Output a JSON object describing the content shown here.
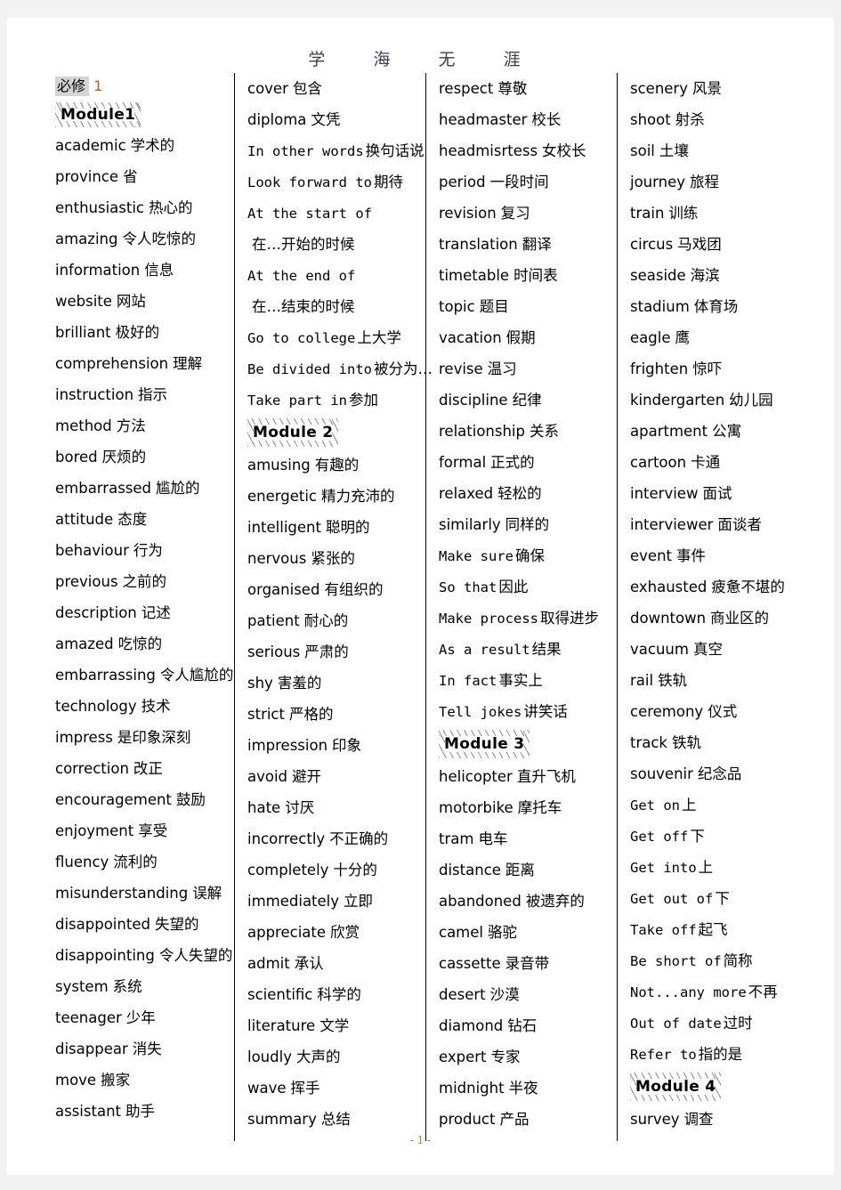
{
  "header": {
    "title": "学  海  无  涯"
  },
  "footer": {
    "prefix": "- ",
    "page_number": "1",
    "suffix": " -"
  },
  "subject": {
    "label_cn": "必修",
    "label_num": "1"
  },
  "columns": [
    {
      "id": "column-1",
      "items": [
        {
          "type": "subject",
          "cn": "必修",
          "num": "1"
        },
        {
          "type": "module",
          "label": "Module1"
        },
        {
          "type": "word",
          "en": "academic",
          "zh": "学术的"
        },
        {
          "type": "word",
          "en": "province",
          "zh": "省"
        },
        {
          "type": "word",
          "en": "enthusiastic",
          "zh": "热心的"
        },
        {
          "type": "word",
          "en": "amazing",
          "zh": "令人吃惊的"
        },
        {
          "type": "word",
          "en": "information",
          "zh": "信息"
        },
        {
          "type": "word",
          "en": "website",
          "zh": "网站"
        },
        {
          "type": "word",
          "en": "brilliant",
          "zh": "极好的"
        },
        {
          "type": "word",
          "en": "comprehension",
          "zh": "理解"
        },
        {
          "type": "word",
          "en": "instruction",
          "zh": "指示"
        },
        {
          "type": "word",
          "en": "method",
          "zh": "方法"
        },
        {
          "type": "word",
          "en": "bored",
          "zh": "厌烦的"
        },
        {
          "type": "word",
          "en": "embarrassed",
          "zh": "尴尬的"
        },
        {
          "type": "word",
          "en": "attitude",
          "zh": "态度"
        },
        {
          "type": "word",
          "en": "behaviour",
          "zh": "行为"
        },
        {
          "type": "word",
          "en": "previous",
          "zh": "之前的"
        },
        {
          "type": "word",
          "en": "description",
          "zh": "记述"
        },
        {
          "type": "word",
          "en": "amazed",
          "zh": "吃惊的"
        },
        {
          "type": "word",
          "en": "embarrassing",
          "zh": "令人尴尬的"
        },
        {
          "type": "word",
          "en": "technology",
          "zh": "技术"
        },
        {
          "type": "word",
          "en": "impress",
          "zh": "是印象深刻"
        },
        {
          "type": "word",
          "en": "correction",
          "zh": "改正"
        },
        {
          "type": "word",
          "en": "encouragement",
          "zh": "鼓励"
        },
        {
          "type": "word",
          "en": "enjoyment",
          "zh": "享受"
        },
        {
          "type": "word",
          "en": "fluency",
          "zh": "流利的"
        },
        {
          "type": "word",
          "en": "misunderstanding",
          "zh": "误解"
        },
        {
          "type": "word",
          "en": "disappointed",
          "zh": "失望的"
        },
        {
          "type": "word",
          "en": "disappointing",
          "zh": "令人失望的"
        },
        {
          "type": "word",
          "en": "system",
          "zh": "系统"
        },
        {
          "type": "word",
          "en": "teenager",
          "zh": "少年"
        },
        {
          "type": "word",
          "en": "disappear",
          "zh": "消失"
        },
        {
          "type": "word",
          "en": "move",
          "zh": "搬家"
        },
        {
          "type": "word",
          "en": "assistant",
          "zh": "助手"
        }
      ]
    },
    {
      "id": "column-2",
      "items": [
        {
          "type": "word",
          "en": "cover",
          "zh": "包含"
        },
        {
          "type": "word",
          "en": "diploma",
          "zh": "文凭"
        },
        {
          "type": "phrase",
          "en": "In other words",
          "zh": "换句话说"
        },
        {
          "type": "phrase",
          "en": "Look forward to",
          "zh": "期待"
        },
        {
          "type": "phrase",
          "en": "At the start of",
          "zh": ""
        },
        {
          "type": "word",
          "en": "",
          "zh": "在…开始的时候"
        },
        {
          "type": "phrase",
          "en": "At the end of",
          "zh": ""
        },
        {
          "type": "word",
          "en": "",
          "zh": "在…结束的时候"
        },
        {
          "type": "phrase",
          "en": "Go to college",
          "zh": "上大学"
        },
        {
          "type": "phrase",
          "en": "Be divided into",
          "zh": "被分为…"
        },
        {
          "type": "phrase",
          "en": "Take part in",
          "zh": "参加"
        },
        {
          "type": "module",
          "label": "Module 2"
        },
        {
          "type": "word",
          "en": "amusing",
          "zh": "有趣的"
        },
        {
          "type": "word",
          "en": "energetic",
          "zh": "精力充沛的"
        },
        {
          "type": "word",
          "en": "intelligent",
          "zh": "聪明的"
        },
        {
          "type": "word",
          "en": "nervous",
          "zh": "紧张的"
        },
        {
          "type": "word",
          "en": "organised",
          "zh": "有组织的"
        },
        {
          "type": "word",
          "en": "patient",
          "zh": "耐心的"
        },
        {
          "type": "word",
          "en": "serious",
          "zh": "严肃的"
        },
        {
          "type": "word",
          "en": "shy",
          "zh": "害羞的"
        },
        {
          "type": "word",
          "en": "strict",
          "zh": "严格的"
        },
        {
          "type": "word",
          "en": "impression",
          "zh": "印象"
        },
        {
          "type": "word",
          "en": "avoid",
          "zh": "避开"
        },
        {
          "type": "word",
          "en": "hate",
          "zh": "讨厌"
        },
        {
          "type": "word",
          "en": "incorrectly",
          "zh": "不正确的"
        },
        {
          "type": "word",
          "en": "completely",
          "zh": "十分的"
        },
        {
          "type": "word",
          "en": "immediately",
          "zh": "立即"
        },
        {
          "type": "word",
          "en": "appreciate",
          "zh": "欣赏"
        },
        {
          "type": "word",
          "en": "admit",
          "zh": "承认"
        },
        {
          "type": "word",
          "en": "scientific",
          "zh": "科学的"
        },
        {
          "type": "word",
          "en": "literature",
          "zh": "文学"
        },
        {
          "type": "word",
          "en": "loudly",
          "zh": "大声的"
        },
        {
          "type": "word",
          "en": "wave",
          "zh": "挥手"
        },
        {
          "type": "word",
          "en": "summary",
          "zh": "总结"
        }
      ]
    },
    {
      "id": "column-3",
      "items": [
        {
          "type": "word",
          "en": "respect",
          "zh": "尊敬"
        },
        {
          "type": "word",
          "en": "headmaster",
          "zh": "校长"
        },
        {
          "type": "word",
          "en": "headmisrtess",
          "zh": "女校长"
        },
        {
          "type": "word",
          "en": "period",
          "zh": "一段时间"
        },
        {
          "type": "word",
          "en": "revision",
          "zh": "复习"
        },
        {
          "type": "word",
          "en": "translation",
          "zh": "翻译"
        },
        {
          "type": "word",
          "en": "timetable",
          "zh": "时间表"
        },
        {
          "type": "word",
          "en": "topic",
          "zh": "题目"
        },
        {
          "type": "word",
          "en": "vacation",
          "zh": "假期"
        },
        {
          "type": "word",
          "en": "revise",
          "zh": "温习"
        },
        {
          "type": "word",
          "en": "discipline",
          "zh": "纪律"
        },
        {
          "type": "word",
          "en": "relationship",
          "zh": "关系"
        },
        {
          "type": "word",
          "en": "formal",
          "zh": "正式的"
        },
        {
          "type": "word",
          "en": "relaxed",
          "zh": "轻松的"
        },
        {
          "type": "word",
          "en": "similarly",
          "zh": "同样的"
        },
        {
          "type": "phrase",
          "en": "Make sure",
          "zh": "确保"
        },
        {
          "type": "phrase",
          "en": "So that",
          "zh": "因此"
        },
        {
          "type": "phrase",
          "en": "Make process",
          "zh": "取得进步"
        },
        {
          "type": "phrase",
          "en": "As a result",
          "zh": "结果"
        },
        {
          "type": "phrase",
          "en": "In fact",
          "zh": "事实上"
        },
        {
          "type": "phrase",
          "en": "Tell jokes",
          "zh": "讲笑话"
        },
        {
          "type": "module",
          "label": "Module 3"
        },
        {
          "type": "word",
          "en": "helicopter",
          "zh": "直升飞机"
        },
        {
          "type": "word",
          "en": "motorbike",
          "zh": "摩托车"
        },
        {
          "type": "word",
          "en": "tram",
          "zh": "电车"
        },
        {
          "type": "word",
          "en": "distance",
          "zh": "距离"
        },
        {
          "type": "word",
          "en": "abandoned",
          "zh": "被遗弃的"
        },
        {
          "type": "word",
          "en": "camel",
          "zh": "骆驼"
        },
        {
          "type": "word",
          "en": "cassette",
          "zh": "录音带"
        },
        {
          "type": "word",
          "en": "desert",
          "zh": "沙漠"
        },
        {
          "type": "word",
          "en": "diamond",
          "zh": "钻石"
        },
        {
          "type": "word",
          "en": "expert",
          "zh": "专家"
        },
        {
          "type": "word",
          "en": "midnight",
          "zh": "半夜"
        },
        {
          "type": "word",
          "en": "product",
          "zh": "产品"
        }
      ]
    },
    {
      "id": "column-4",
      "items": [
        {
          "type": "word",
          "en": "scenery",
          "zh": "风景"
        },
        {
          "type": "word",
          "en": "shoot",
          "zh": "射杀"
        },
        {
          "type": "word",
          "en": "soil",
          "zh": "土壤"
        },
        {
          "type": "word",
          "en": "journey",
          "zh": "旅程"
        },
        {
          "type": "word",
          "en": "train",
          "zh": "训练"
        },
        {
          "type": "word",
          "en": "circus",
          "zh": "马戏团"
        },
        {
          "type": "word",
          "en": "seaside",
          "zh": "海滨"
        },
        {
          "type": "word",
          "en": "stadium",
          "zh": "体育场"
        },
        {
          "type": "word",
          "en": "eagle",
          "zh": "鹰"
        },
        {
          "type": "word",
          "en": "frighten",
          "zh": "惊吓"
        },
        {
          "type": "word",
          "en": "kindergarten",
          "zh": "幼儿园"
        },
        {
          "type": "word",
          "en": "apartment",
          "zh": "公寓"
        },
        {
          "type": "word",
          "en": "cartoon",
          "zh": "卡通"
        },
        {
          "type": "word",
          "en": "interview",
          "zh": "面试"
        },
        {
          "type": "word",
          "en": "interviewer",
          "zh": "面谈者"
        },
        {
          "type": "word",
          "en": "event",
          "zh": "事件"
        },
        {
          "type": "word",
          "en": "exhausted",
          "zh": "疲惫不堪的"
        },
        {
          "type": "word",
          "en": "downtown",
          "zh": "商业区的"
        },
        {
          "type": "word",
          "en": "vacuum",
          "zh": "真空"
        },
        {
          "type": "word",
          "en": "rail",
          "zh": "铁轨"
        },
        {
          "type": "word",
          "en": "ceremony",
          "zh": "仪式"
        },
        {
          "type": "word",
          "en": "track",
          "zh": "铁轨"
        },
        {
          "type": "word",
          "en": "souvenir",
          "zh": "纪念品"
        },
        {
          "type": "phrase",
          "en": "Get on",
          "zh": "上"
        },
        {
          "type": "phrase",
          "en": "Get off",
          "zh": "下"
        },
        {
          "type": "phrase",
          "en": "Get into",
          "zh": "上"
        },
        {
          "type": "phrase",
          "en": "Get out of",
          "zh": "下"
        },
        {
          "type": "phrase",
          "en": "Take off",
          "zh": "起飞"
        },
        {
          "type": "phrase",
          "en": "Be short of",
          "zh": "简称"
        },
        {
          "type": "phrase",
          "en": "Not...any more",
          "zh": "不再"
        },
        {
          "type": "phrase",
          "en": "Out of date",
          "zh": "过时"
        },
        {
          "type": "phrase",
          "en": "Refer to",
          "zh": "指的是"
        },
        {
          "type": "module",
          "label": "Module 4"
        },
        {
          "type": "word",
          "en": "survey",
          "zh": "调查"
        }
      ]
    }
  ]
}
